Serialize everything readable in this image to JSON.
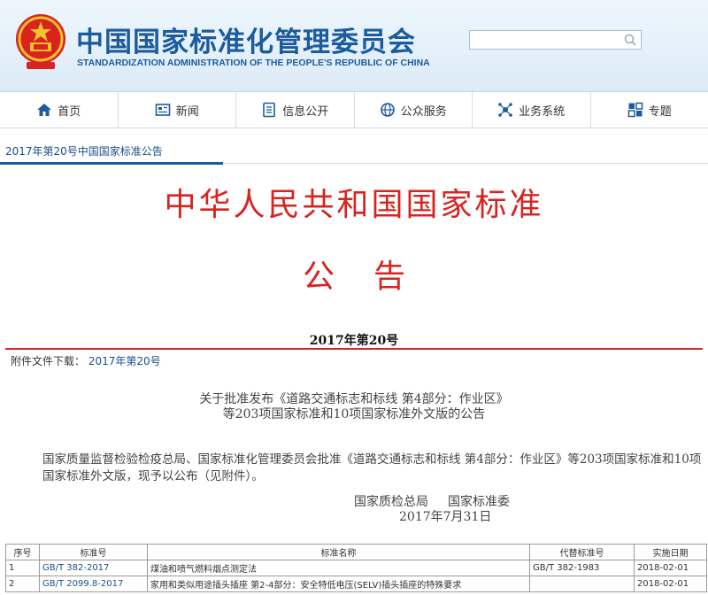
{
  "header": {
    "cn_title": "中国国家标准化管理委员会",
    "en_title": "STANDARDIZATION ADMINISTRATION OF THE PEOPLE'S REPUBLIC OF CHINA",
    "search_value": ""
  },
  "nav": [
    {
      "label": "首页",
      "icon": "home-icon"
    },
    {
      "label": "新闻",
      "icon": "news-icon"
    },
    {
      "label": "信息公开",
      "icon": "document-icon"
    },
    {
      "label": "公众服务",
      "icon": "globe-icon"
    },
    {
      "label": "业务系统",
      "icon": "network-icon"
    },
    {
      "label": "专题",
      "icon": "topic-icon"
    }
  ],
  "breadcrumb": "2017年第20号中国国家标准公告",
  "notice": {
    "title": "中华人民共和国国家标准",
    "subtitle": "公告",
    "issue": "2017年第20号",
    "attachment_label": "附件文件下载：",
    "attachment_link": "2017年第20号",
    "doc_title_line1": "关于批准发布《道路交通标志和标线 第4部分：作业区》",
    "doc_title_line2": "等203项国家标准和10项国家标准外文版的公告",
    "body": "国家质量监督检验检疫总局、国家标准化管理委员会批准《道路交通标志和标线 第4部分：作业区》等203项国家标准和10项国家标准外文版，现予以公布（见附件）。",
    "signer1": "国家质检总局",
    "signer2": "国家标准委",
    "date": "2017年7月31日"
  },
  "table": {
    "headers": [
      "序号",
      "标准号",
      "标准名称",
      "代替标准号",
      "实施日期"
    ],
    "rows": [
      [
        "1",
        "GB/T 382-2017",
        "煤油和喷气燃料烟点测定法",
        "GB/T 382-1983",
        "2018-02-01"
      ],
      [
        "2",
        "GB/T 2099.8-2017",
        "家用和类似用途插头插座 第2-4部分：安全特低电压(SELV)插头插座的特殊要求",
        "",
        "2018-02-01"
      ]
    ]
  },
  "colors": {
    "brand_blue": "#1b5b9e",
    "title_red": "#d8231f"
  }
}
